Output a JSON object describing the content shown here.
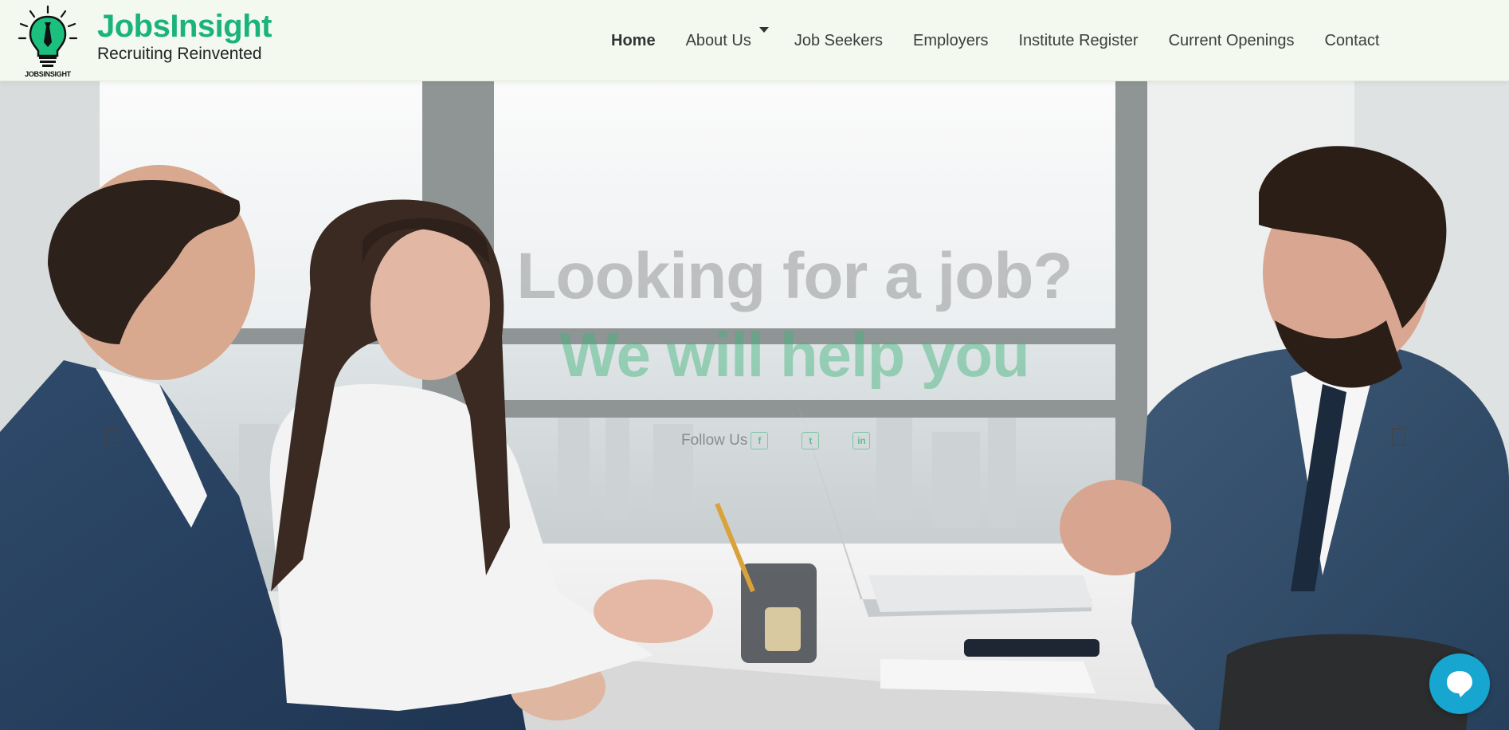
{
  "brand": {
    "name": "JobsInsight",
    "tagline": "Recruiting Reinvented",
    "logo_caption": "JOBSINSIGHT"
  },
  "nav": {
    "items": [
      {
        "label": "Home",
        "active": true
      },
      {
        "label": "About Us",
        "has_dropdown": true
      },
      {
        "label": "Job Seekers"
      },
      {
        "label": "Employers"
      },
      {
        "label": "Institute Register"
      },
      {
        "label": "Current Openings"
      },
      {
        "label": "Contact"
      }
    ]
  },
  "hero": {
    "title": "Looking for a job?",
    "subtitle": "We will help you",
    "follow_label": "Follow Us",
    "social": [
      {
        "icon": "facebook-icon",
        "glyph": "f"
      },
      {
        "icon": "twitter-icon",
        "glyph": "t"
      },
      {
        "icon": "linkedin-icon",
        "glyph": "in"
      }
    ],
    "carousel_prev_icon": "slider-prev-icon",
    "carousel_next_icon": "slider-next-icon"
  },
  "chat": {
    "icon": "chat-bubble-icon"
  },
  "colors": {
    "brand_green": "#1ab37a",
    "header_bg": "#f3f9ef",
    "chat_blue": "#16a6cf"
  }
}
